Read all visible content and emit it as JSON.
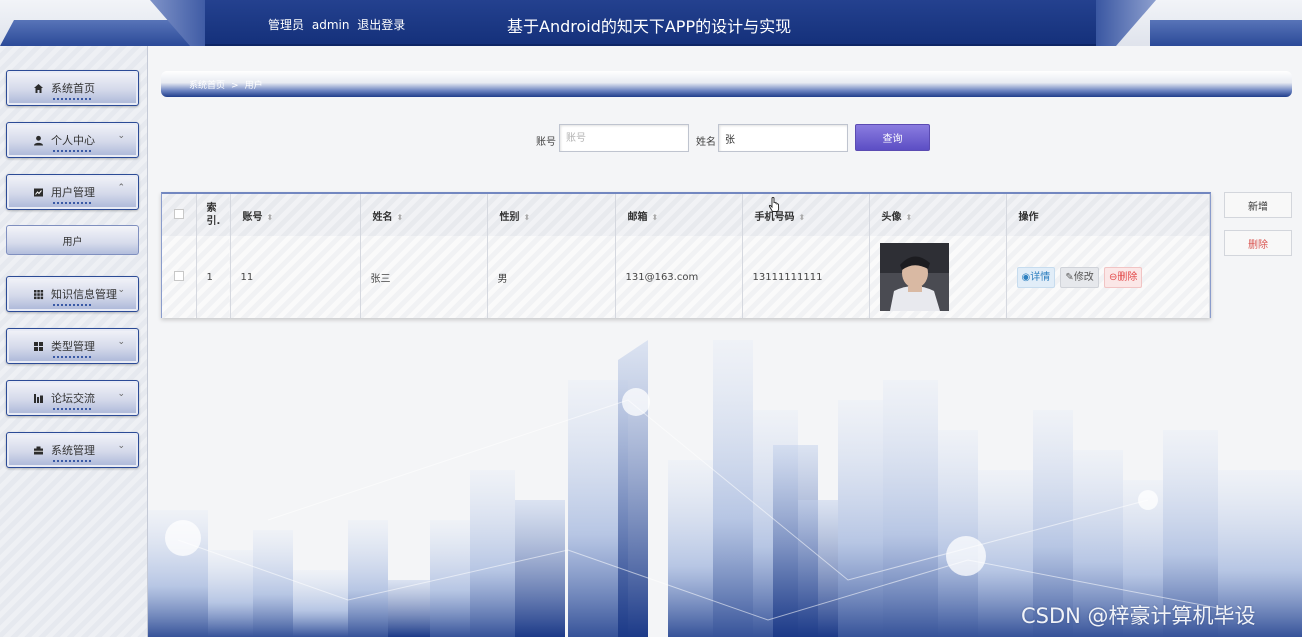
{
  "header": {
    "admin_role": "管理员",
    "admin_name": "admin",
    "logout": "退出登录",
    "title": "基于Android的知天下APP的设计与实现"
  },
  "sidebar": {
    "items": [
      {
        "label": "系统首页",
        "icon": "home-icon",
        "glyph": "⌂"
      },
      {
        "label": "个人中心",
        "icon": "user-icon",
        "glyph": "●",
        "chevron": "⌄"
      },
      {
        "label": "用户管理",
        "icon": "user-manage-icon",
        "glyph": "▣",
        "chevron": "⌃"
      },
      {
        "label": "知识信息管理",
        "icon": "grid-icon",
        "glyph": "▦",
        "chevron": "⌄"
      },
      {
        "label": "类型管理",
        "icon": "apps-icon",
        "glyph": "▪▪",
        "chevron": "⌄"
      },
      {
        "label": "论坛交流",
        "icon": "chart-icon",
        "glyph": "▮",
        "chevron": "⌄"
      },
      {
        "label": "系统管理",
        "icon": "briefcase-icon",
        "glyph": "▬",
        "chevron": "⌄"
      }
    ],
    "sub_item": "用户"
  },
  "breadcrumb": {
    "home": "系统首页",
    "separator": ">",
    "current": "用户"
  },
  "search": {
    "account_label": "账号",
    "account_placeholder": "账号",
    "account_value": "",
    "name_label": "姓名",
    "name_value": "张",
    "button": "查询"
  },
  "actions": {
    "add": "新增",
    "delete": "删除"
  },
  "table": {
    "columns": [
      "索引",
      "账号",
      "姓名",
      "性别",
      "邮箱",
      "手机号码",
      "头像",
      "操作"
    ],
    "index_header_line1": "索",
    "index_header_line2": "引.",
    "rows": [
      {
        "index": "1",
        "account": "11",
        "name": "张三",
        "gender": "男",
        "email": "131@163.com",
        "phone": "13111111111",
        "detail": "详情",
        "edit": "修改",
        "delete": "删除"
      }
    ]
  },
  "watermark": "CSDN @梓豪计算机毕设",
  "colors": {
    "header_navy": "#1a3680",
    "sidebar_border": "#2c4b96",
    "search_button": "#6c5ed0",
    "detail": "#2d7fbf",
    "delete": "#e24646"
  }
}
